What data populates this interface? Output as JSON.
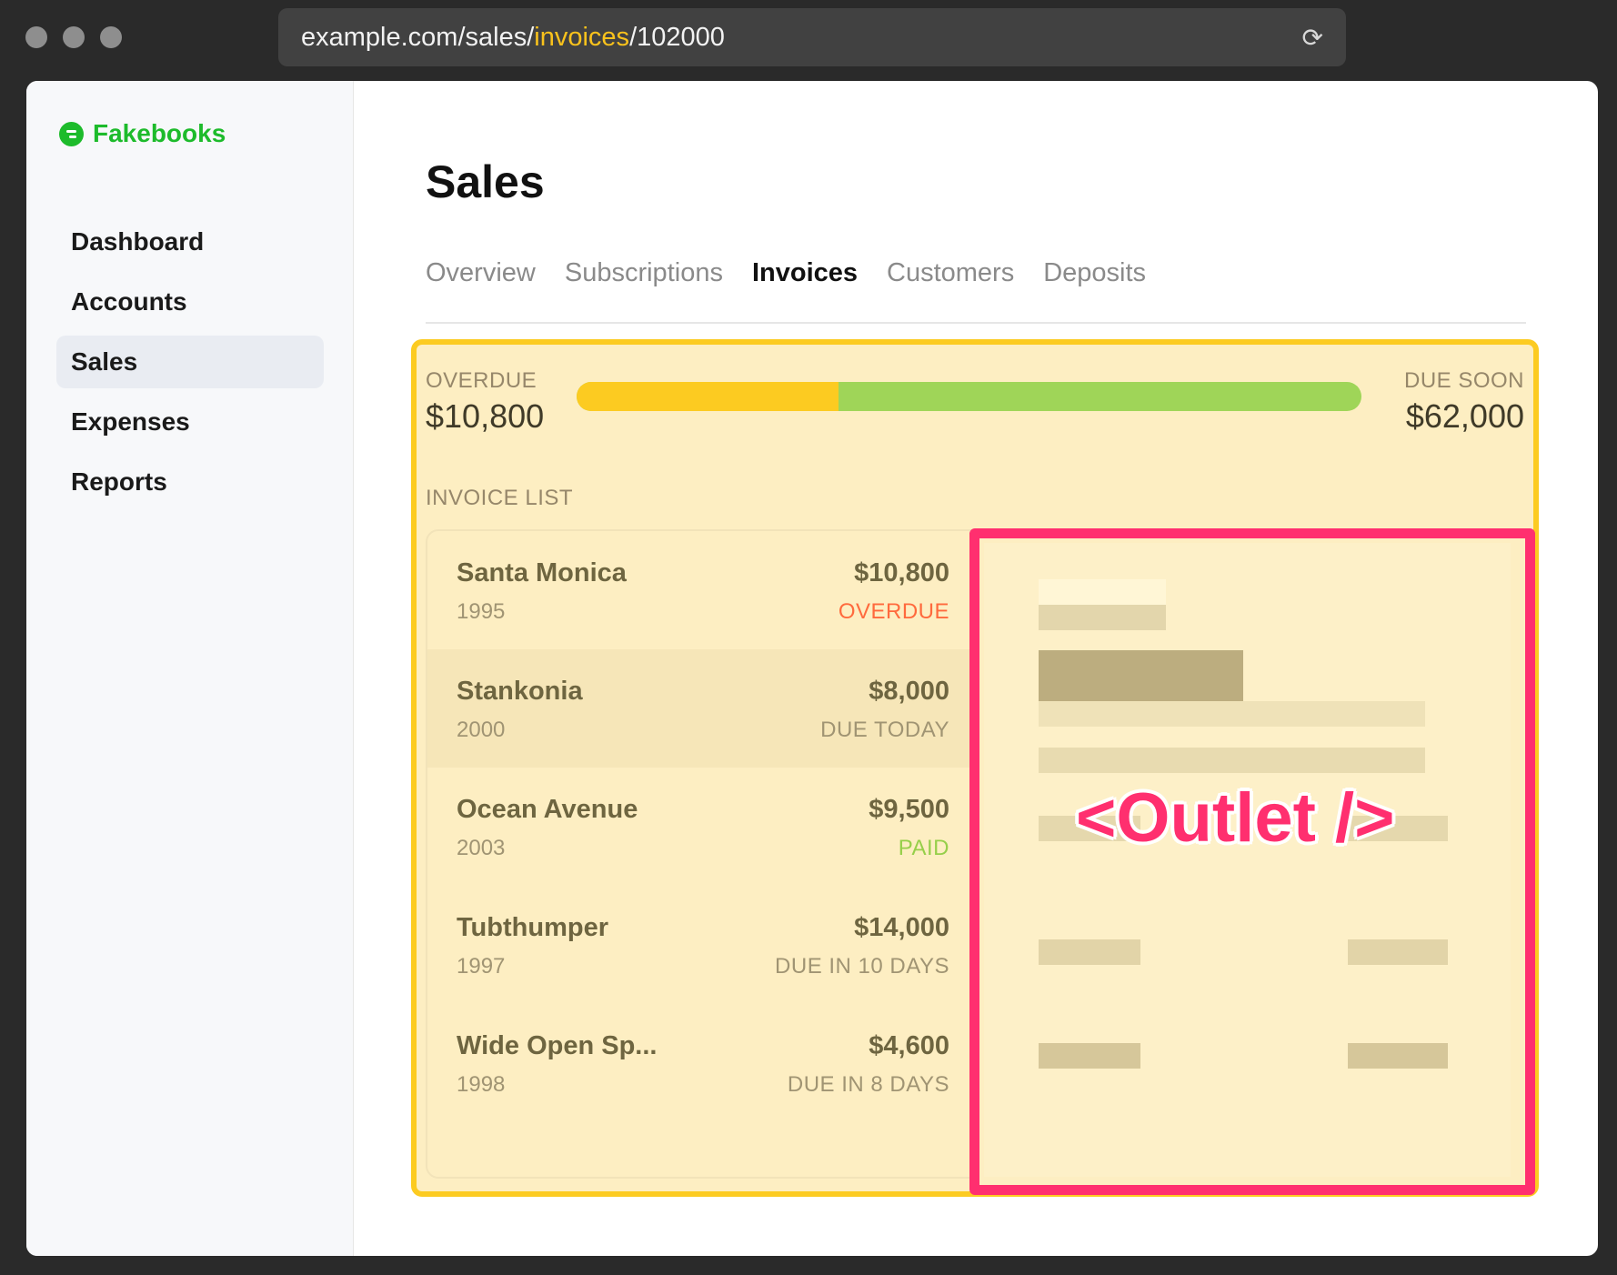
{
  "browser": {
    "url_prefix": "example.com/sales/",
    "url_highlight": "invoices",
    "url_suffix": "/102000",
    "reload_icon": "⟳"
  },
  "brand": {
    "name": "Fakebooks",
    "color": "#1dbb2b"
  },
  "sidebar": {
    "items": [
      {
        "label": "Dashboard",
        "active": false
      },
      {
        "label": "Accounts",
        "active": false
      },
      {
        "label": "Sales",
        "active": true
      },
      {
        "label": "Expenses",
        "active": false
      },
      {
        "label": "Reports",
        "active": false
      }
    ]
  },
  "page": {
    "title": "Sales",
    "tabs": [
      {
        "label": "Overview",
        "active": false
      },
      {
        "label": "Subscriptions",
        "active": false
      },
      {
        "label": "Invoices",
        "active": true
      },
      {
        "label": "Customers",
        "active": false
      },
      {
        "label": "Deposits",
        "active": false
      }
    ]
  },
  "summary": {
    "overdue_label": "OVERDUE",
    "overdue_amount": "$10,800",
    "due_soon_label": "DUE SOON",
    "due_soon_amount": "$62,000",
    "overdue_fraction": 0.334,
    "colors": {
      "overdue": "#fccb21",
      "due_soon": "#9fd558"
    }
  },
  "invoice_list": {
    "label": "INVOICE LIST",
    "rows": [
      {
        "name": "Santa Monica",
        "year": "1995",
        "amount": "$10,800",
        "status": "OVERDUE",
        "status_color": "#ff6a3d",
        "active": false
      },
      {
        "name": "Stankonia",
        "year": "2000",
        "amount": "$8,000",
        "status": "DUE TODAY",
        "status_color": "#a09473",
        "active": true
      },
      {
        "name": "Ocean Avenue",
        "year": "2003",
        "amount": "$9,500",
        "status": "PAID",
        "status_color": "#96cf4a",
        "active": false
      },
      {
        "name": "Tubthumper",
        "year": "1997",
        "amount": "$14,000",
        "status": "DUE IN 10 DAYS",
        "status_color": "#a09473",
        "active": false
      },
      {
        "name": "Wide Open Sp...",
        "year": "1998",
        "amount": "$4,600",
        "status": "DUE IN 8 DAYS",
        "status_color": "#a09473",
        "active": false
      }
    ]
  },
  "outlet": {
    "label": "<Outlet />",
    "color": "#ff2f6f"
  },
  "highlight_colors": {
    "invoices_region": "#fccb21",
    "outlet_region": "#ff2f6f"
  }
}
